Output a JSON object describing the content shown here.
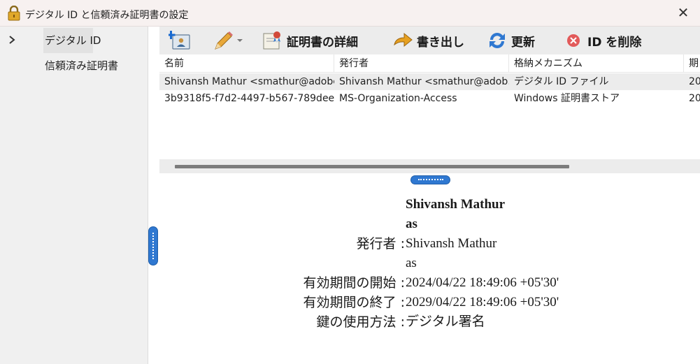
{
  "window": {
    "title": "デジタル ID と信頼済み証明書の設定",
    "close_glyph": "✕"
  },
  "sidebar": {
    "items": [
      {
        "label": "デジタル ID",
        "selected": true
      },
      {
        "label": "信頼済み証明書",
        "selected": false
      }
    ]
  },
  "toolbar": {
    "add_id": {
      "icon": "add-id-icon"
    },
    "edit": {
      "icon": "pencil-icon"
    },
    "details_label": "証明書の詳細",
    "export_label": "書き出し",
    "refresh_label": "更新",
    "remove_label": "ID を削除"
  },
  "table": {
    "columns": [
      "名前",
      "発行者",
      "格納メカニズム",
      "期"
    ],
    "rows": [
      [
        "Shivansh Mathur <smathur@adobe…",
        "Shivansh Mathur <smathur@adob…",
        "デジタル ID ファイル",
        "20"
      ],
      [
        "3b9318f5-f7d2-4497-b567-789dee…",
        "MS-Organization-Access",
        "Windows 証明書ストア",
        "20"
      ]
    ]
  },
  "details": {
    "name": "Shivansh Mathur",
    "name_suffix": "as",
    "issuer_label": "発行者 :",
    "issuer_value": "Shivansh Mathur",
    "issuer_suffix": "as",
    "valid_from_label": "有効期間の開始 :",
    "valid_from_value": "2024/04/22 18:49:06 +05'30'",
    "valid_to_label": "有効期間の終了 :",
    "valid_to_value": "2029/04/22 18:49:06 +05'30'",
    "key_usage_label": "鍵の使用方法 :",
    "key_usage_value": "デジタル署名"
  },
  "colors": {
    "accent": "#2f78d1",
    "toolbar_bg": "#ececec",
    "sidebar_bg": "#f0f0f0",
    "title_bg": "#f7f1f0"
  }
}
